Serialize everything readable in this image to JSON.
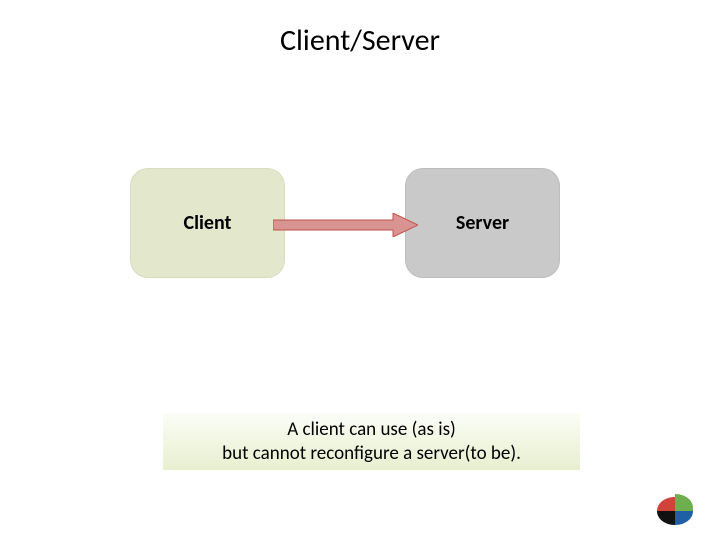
{
  "title": "Client/Server",
  "nodes": {
    "client": "Client",
    "server": "Server"
  },
  "caption": {
    "line1": "A client can use (as is)",
    "line2": "but cannot reconfigure a server(to be)."
  },
  "arrow": {
    "color_fill": "#d99491",
    "color_stroke": "#c0524e"
  },
  "colors": {
    "client_bg": "#e3e8cd",
    "server_bg": "#c9c9c9",
    "caption_grad_top": "#fbfdf6",
    "caption_grad_bottom": "#e8efcf"
  },
  "logo": {
    "green": "#6fae4f",
    "red": "#d0423a",
    "blue": "#1f5fa6",
    "black": "#111111"
  }
}
